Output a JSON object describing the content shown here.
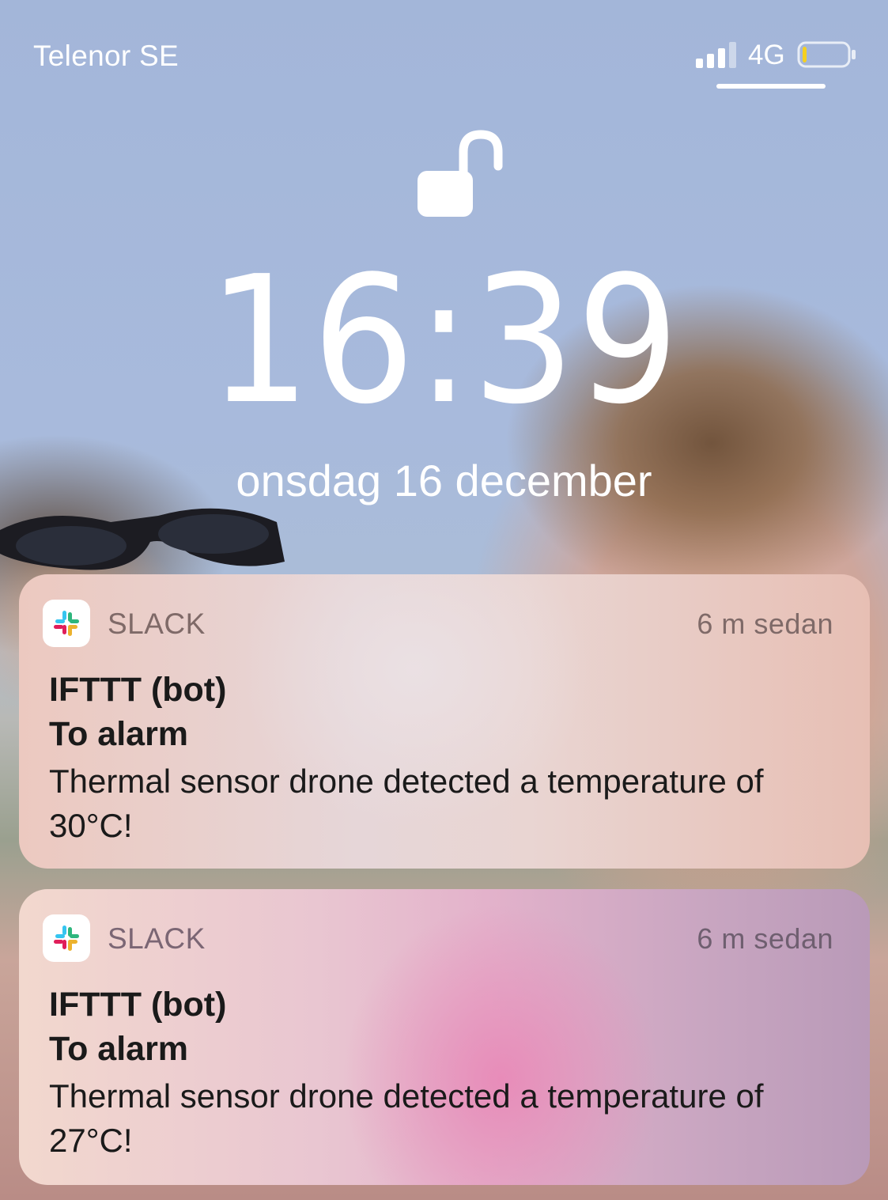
{
  "status_bar": {
    "carrier": "Telenor SE",
    "network": "4G",
    "battery_level": 0.1,
    "signal_bars": 3
  },
  "lock_screen": {
    "time": "16:39",
    "date": "onsdag 16 december",
    "lock_state": "unlocked"
  },
  "notifications": [
    {
      "app": "SLACK",
      "timestamp": "6 m sedan",
      "sender": "IFTTT (bot)",
      "channel": "To alarm",
      "message": "Thermal sensor drone detected a temperature of 30°C!"
    },
    {
      "app": "SLACK",
      "timestamp": "6 m sedan",
      "sender": "IFTTT (bot)",
      "channel": "To alarm",
      "message": "Thermal sensor drone detected a temperature of 27°C!"
    }
  ],
  "colors": {
    "sky": "#a8badc",
    "battery_low": "#f5d020",
    "text_white": "#ffffff",
    "slack_blue": "#36c5f0",
    "slack_green": "#2eb67d",
    "slack_yellow": "#ecb22e",
    "slack_red": "#e01e5a"
  }
}
